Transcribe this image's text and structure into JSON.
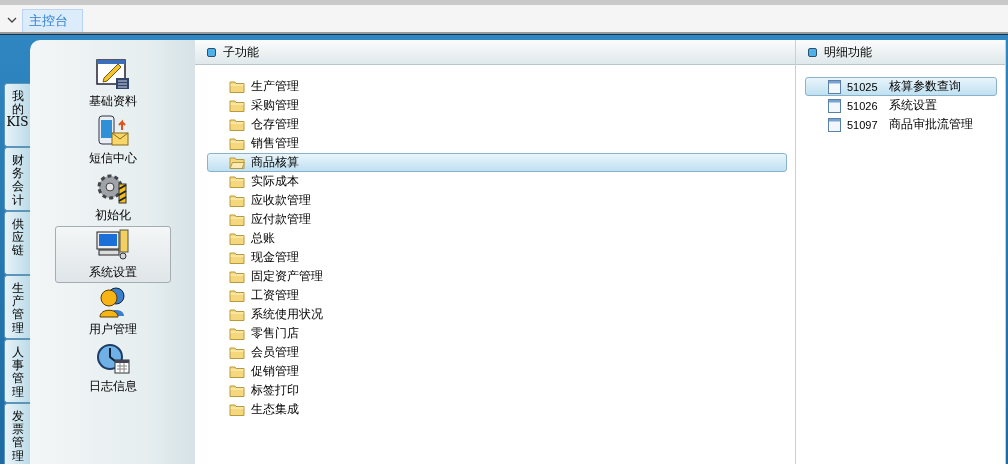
{
  "tab_bar": {
    "tabs": [
      {
        "label": "主控台",
        "selected": true
      }
    ]
  },
  "side_tabs": [
    {
      "label": "我的KIS"
    },
    {
      "label": "财务会计"
    },
    {
      "label": "供应链"
    },
    {
      "label": "生产管理"
    },
    {
      "label": "人事管理"
    },
    {
      "label": "发票管理"
    }
  ],
  "nav_items": [
    {
      "label": "基础资料",
      "selected": false
    },
    {
      "label": "短信中心",
      "selected": false
    },
    {
      "label": "初始化",
      "selected": false
    },
    {
      "label": "系统设置",
      "selected": true
    },
    {
      "label": "用户管理",
      "selected": false
    },
    {
      "label": "日志信息",
      "selected": false
    }
  ],
  "sub_functions": {
    "title": "子功能",
    "items": [
      {
        "label": "生产管理",
        "selected": false
      },
      {
        "label": "采购管理",
        "selected": false
      },
      {
        "label": "仓存管理",
        "selected": false
      },
      {
        "label": "销售管理",
        "selected": false
      },
      {
        "label": "商品核算",
        "selected": true
      },
      {
        "label": "实际成本",
        "selected": false
      },
      {
        "label": "应收款管理",
        "selected": false
      },
      {
        "label": "应付款管理",
        "selected": false
      },
      {
        "label": "总账",
        "selected": false
      },
      {
        "label": "现金管理",
        "selected": false
      },
      {
        "label": "固定资产管理",
        "selected": false
      },
      {
        "label": "工资管理",
        "selected": false
      },
      {
        "label": "系统使用状况",
        "selected": false
      },
      {
        "label": "零售门店",
        "selected": false
      },
      {
        "label": "会员管理",
        "selected": false
      },
      {
        "label": "促销管理",
        "selected": false
      },
      {
        "label": "标签打印",
        "selected": false
      },
      {
        "label": "生态集成",
        "selected": false
      }
    ]
  },
  "detail_functions": {
    "title": "明细功能",
    "items": [
      {
        "code": "51025",
        "label": "核算参数查询",
        "selected": true
      },
      {
        "code": "51026",
        "label": "系统设置",
        "selected": false
      },
      {
        "code": "51097",
        "label": "商品审批流管理",
        "selected": false
      }
    ]
  }
}
